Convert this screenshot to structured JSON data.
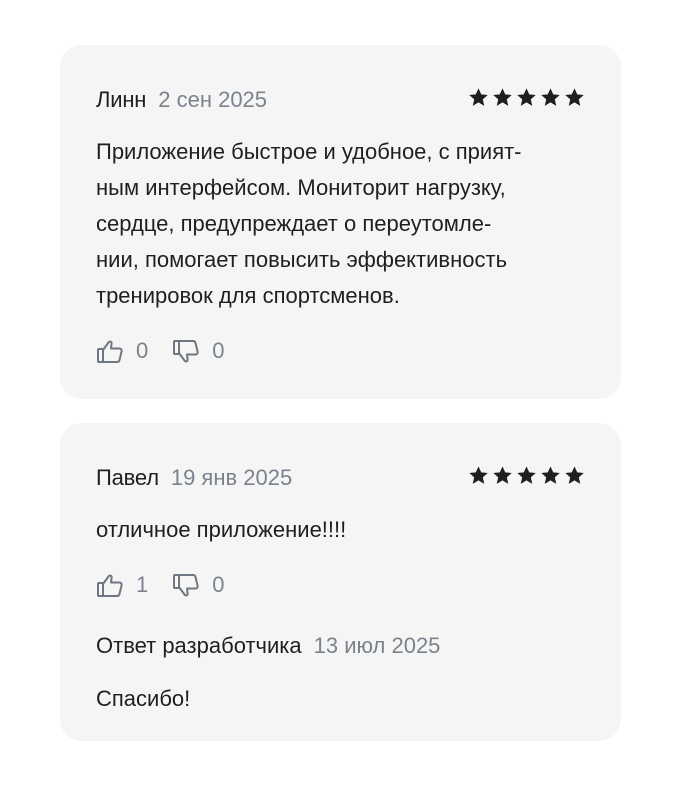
{
  "reviews": [
    {
      "author": "Линн",
      "date": "2 сен 2025",
      "rating": 5,
      "text_lines": [
        "Приложение быстрое и удобное, с прият-",
        "ным интерфейсом. Мониторит нагрузку,",
        "сердце, предупреждает о переутомле-",
        "нии, помогает повысить эффективность",
        "тренировок для спортсменов."
      ],
      "likes": "0",
      "dislikes": "0"
    },
    {
      "author": "Павел",
      "date": "19 янв 2025",
      "rating": 5,
      "text_lines": [
        "отличное приложение!!!!"
      ],
      "likes": "1",
      "dislikes": "0",
      "developer_reply": {
        "title": "Ответ разработчика",
        "date": "13 июл 2025",
        "text": "Спасибо!"
      }
    }
  ],
  "colors": {
    "card_background": "#f5f5f5",
    "text": "#1f1f1f",
    "muted": "#7a838d",
    "star": "#1f1f1f"
  },
  "icons": {
    "star": "star-icon",
    "like": "thumbs-up-icon",
    "dislike": "thumbs-down-icon"
  }
}
